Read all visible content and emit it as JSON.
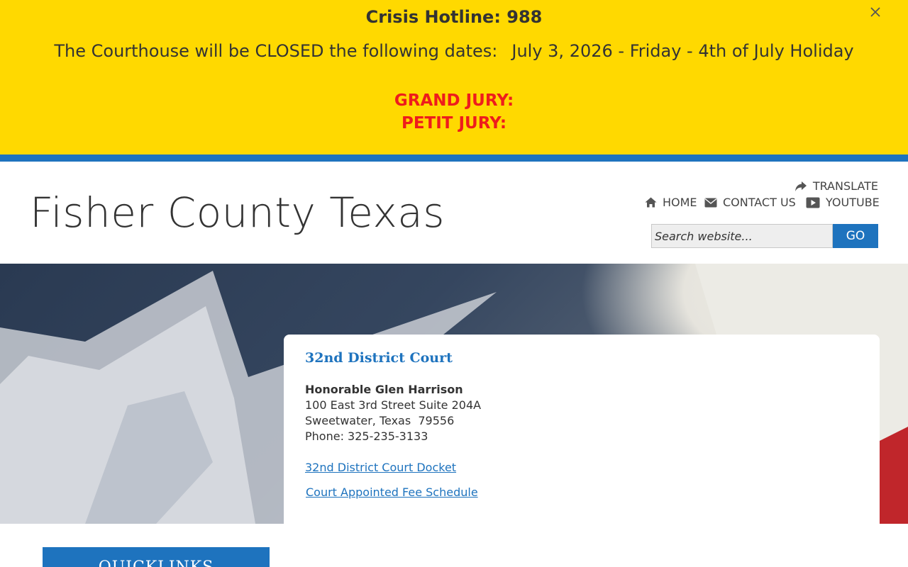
{
  "alert": {
    "hotline": "Crisis Hotline:  988",
    "closed_label": "The Courthouse will be CLOSED the following dates:",
    "closed_date": "July 3, 2026 - Friday - 4th of July Holiday",
    "grand_jury": "GRAND JURY:",
    "petit_jury": "PETIT JURY:",
    "close_icon": "close-icon",
    "background_color": "#ffd900",
    "jury_color": "#ee1c1c"
  },
  "header": {
    "site_title": "Fisher County Texas",
    "translate": "TRANSLATE",
    "nav": {
      "home": "HOME",
      "contact": "CONTACT US",
      "youtube": "YOUTUBE"
    },
    "icons": {
      "translate": "share-arrow-icon",
      "home": "home-icon",
      "contact": "envelope-icon",
      "youtube": "youtube-icon"
    },
    "search": {
      "placeholder": "Search website...",
      "button": "GO"
    },
    "accent_color": "#1e73be"
  },
  "main": {
    "court_title": "32nd District Court",
    "judge": "Honorable Glen Harrison",
    "address_1": "100 East 3rd Street Suite 204A",
    "address_2": "Sweetwater, Texas  79556",
    "phone": "Phone: 325-235-3133",
    "links": {
      "docket": "32nd District Court Docket",
      "fee_schedule": "Court Appointed Fee Schedule"
    }
  },
  "sidebar": {
    "quicklinks_title": "QUICKLINKS"
  }
}
